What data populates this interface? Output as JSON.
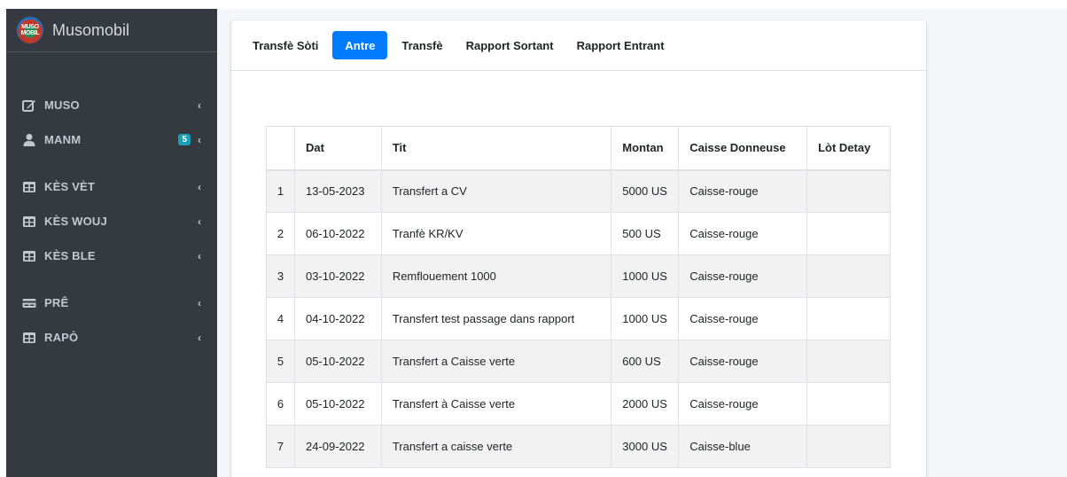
{
  "brand": {
    "logo_text": "MUSO MOBIL",
    "name": "Musomobil"
  },
  "sidebar": {
    "items": [
      {
        "label": "MUSO",
        "icon": "edit-icon"
      },
      {
        "label": "MANM",
        "icon": "user-icon",
        "badge": "5"
      },
      {
        "label": "KÈS VÈT",
        "icon": "table-icon"
      },
      {
        "label": "KÈS WOUJ",
        "icon": "table-icon"
      },
      {
        "label": "KÈS BLE",
        "icon": "table-icon"
      },
      {
        "label": "PRÊ",
        "icon": "credit-card-icon"
      },
      {
        "label": "RAPÒ",
        "icon": "table-icon"
      }
    ],
    "chevron": "‹"
  },
  "tabs": [
    {
      "label": "Transfè Sòti",
      "active": false
    },
    {
      "label": "Antre",
      "active": true
    },
    {
      "label": "Transfè",
      "active": false
    },
    {
      "label": "Rapport Sortant",
      "active": false
    },
    {
      "label": "Rapport Entrant",
      "active": false
    }
  ],
  "table": {
    "headers": [
      "",
      "Dat",
      "Tit",
      "Montan",
      "Caisse Donneuse",
      "Lòt Detay"
    ],
    "rows": [
      [
        "1",
        "13-05-2023",
        "Transfert a CV",
        "5000 US",
        "Caisse-rouge",
        ""
      ],
      [
        "2",
        "06-10-2022",
        "Tranfè KR/KV",
        "500 US",
        "Caisse-rouge",
        ""
      ],
      [
        "3",
        "03-10-2022",
        "Remflouement 1000",
        "1000 US",
        "Caisse-rouge",
        ""
      ],
      [
        "4",
        "04-10-2022",
        "Transfert test passage dans rapport",
        "1000 US",
        "Caisse-rouge",
        ""
      ],
      [
        "5",
        "05-10-2022",
        "Transfert a Caisse verte",
        "600 US",
        "Caisse-rouge",
        ""
      ],
      [
        "6",
        "05-10-2022",
        "Transfert à Caisse verte",
        "2000 US",
        "Caisse-rouge",
        ""
      ],
      [
        "7",
        "24-09-2022",
        "Transfert a caisse verte",
        "3000 US",
        "Caisse-blue",
        ""
      ]
    ]
  },
  "colors": {
    "sidebar_bg": "#343a40",
    "accent": "#007bff",
    "badge": "#17a2b8"
  }
}
